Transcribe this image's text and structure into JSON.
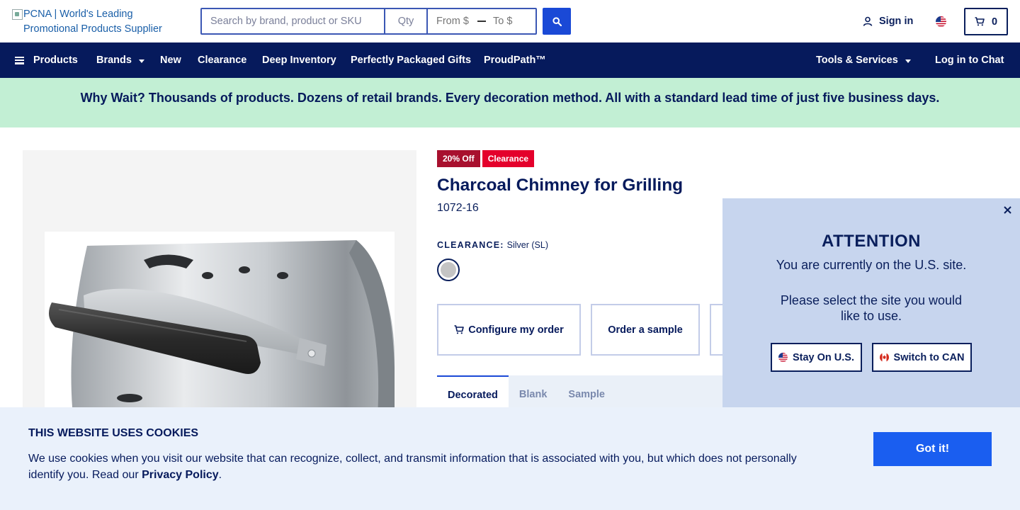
{
  "header": {
    "logo_alt": "PCNA | World's Leading Promotional Products Supplier",
    "search": {
      "placeholder": "Search by brand, product or SKU",
      "value": ""
    },
    "qty": {
      "placeholder": "Qty",
      "value": ""
    },
    "price_from": {
      "placeholder": "From $",
      "value": ""
    },
    "price_to": {
      "placeholder": "To $",
      "value": ""
    },
    "search_button_icon": "search-icon",
    "signin_label": "Sign in",
    "country_flag": "us-flag-icon",
    "cart_count": "0",
    "brand_color": "#061a5c",
    "accent_color": "#1a49d6"
  },
  "nav": {
    "products_label": "Products",
    "items": [
      {
        "label": "Brands",
        "has_caret": true
      },
      {
        "label": "New"
      },
      {
        "label": "Clearance"
      },
      {
        "label": "Deep Inventory"
      },
      {
        "label": "Perfectly Packaged Gifts"
      },
      {
        "label": "ProudPath™"
      }
    ],
    "tools_label": "Tools & Services",
    "chat_label": "Log in to Chat"
  },
  "banner": {
    "text": "Why Wait? Thousands of products. Dozens of retail brands. Every decoration method. All with a standard lead time of just five business days."
  },
  "product": {
    "badges": [
      {
        "label": "20% Off",
        "color": "#a8102e"
      },
      {
        "label": "Clearance",
        "color": "#e4002b"
      }
    ],
    "title": "Charcoal Chimney for Grilling",
    "sku": "1072-16",
    "color_label": "CLEARANCE:",
    "color_value": "Silver (SL)",
    "swatch_color": "#c4c4c4",
    "actions": {
      "configure": "Configure my order",
      "sample": "Order a sample"
    },
    "tabs": [
      {
        "label": "Decorated",
        "active": true
      },
      {
        "label": "Blank",
        "active": false
      },
      {
        "label": "Sample",
        "active": false
      }
    ]
  },
  "attention": {
    "title": "ATTENTION",
    "line1": "You are currently on the U.S. site.",
    "line2": "Please select the site you would like to use.",
    "stay_label": "Stay On U.S.",
    "switch_label": "Switch to CAN"
  },
  "cookie": {
    "title": "THIS WEBSITE USES COOKIES",
    "text": "We use cookies when you visit our website that can recognize, collect, and transmit information that is associated with you, but which does not personally identify you. Read our",
    "link_label": "Privacy Policy",
    "text_end": ".",
    "button_label": "Got it!"
  }
}
